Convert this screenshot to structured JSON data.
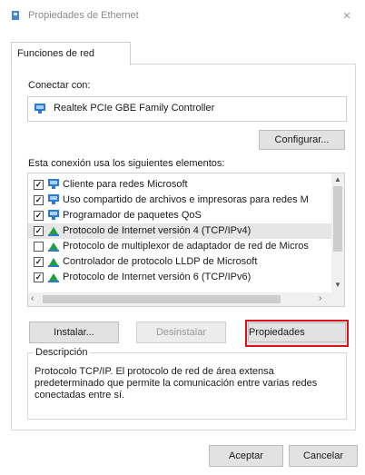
{
  "window": {
    "title": "Propiedades de Ethernet",
    "close_glyph": "×"
  },
  "tab": {
    "label": "Funciones de red"
  },
  "connection": {
    "label": "Conectar con:",
    "adapter": "Realtek PCIe GBE Family Controller",
    "adapter_icon": "network-adapter-icon"
  },
  "configure_label": "Configurar...",
  "items": {
    "label": "Esta conexión usa los siguientes elementos:",
    "rows": [
      {
        "checked": true,
        "text": "Cliente para redes Microsoft",
        "icon": "network-client-icon",
        "selected": false
      },
      {
        "checked": true,
        "text": "Uso compartido de archivos e impresoras para redes M",
        "icon": "network-client-icon",
        "selected": false
      },
      {
        "checked": true,
        "text": "Programador de paquetes QoS",
        "icon": "network-client-icon",
        "selected": false
      },
      {
        "checked": true,
        "text": "Protocolo de Internet versión 4 (TCP/IPv4)",
        "icon": "protocol-icon",
        "selected": true
      },
      {
        "checked": false,
        "text": "Protocolo de multiplexor de adaptador de red de Micros",
        "icon": "protocol-icon",
        "selected": false
      },
      {
        "checked": true,
        "text": "Controlador de protocolo LLDP de Microsoft",
        "icon": "protocol-icon",
        "selected": false
      },
      {
        "checked": true,
        "text": "Protocolo de Internet versión 6 (TCP/IPv6)",
        "icon": "protocol-icon",
        "selected": false
      }
    ]
  },
  "buttons": {
    "install": "Instalar...",
    "uninstall": "Desinstalar",
    "properties": "Propiedades",
    "accept": "Aceptar",
    "cancel": "Cancelar"
  },
  "description": {
    "label": "Descripción",
    "text": "Protocolo TCP/IP. El protocolo de red de área extensa predeterminado que permite la comunicación entre varias redes conectadas entre sí."
  },
  "colors": {
    "highlight_border": "#d6141c",
    "icon_blue": "#2b7bd4",
    "icon_green": "#1f9e3a"
  }
}
